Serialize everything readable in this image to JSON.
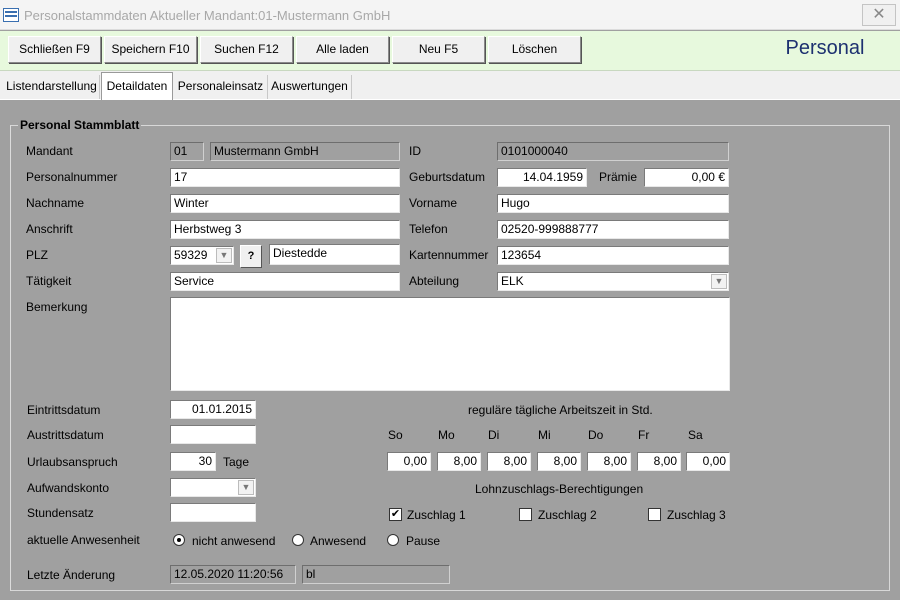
{
  "window": {
    "title": "Personalstammdaten Aktueller Mandant:01-Mustermann GmbH",
    "close_glyph": "✕"
  },
  "toolbar": {
    "buttons": [
      "Schließen F9",
      "Speichern F10",
      "Suchen F12",
      "Alle laden",
      "Neu F5",
      "Löschen"
    ],
    "brand": "Personal"
  },
  "tabs": [
    "Listendarstellung",
    "Detaildaten",
    "Personaleinsatz",
    "Auswertungen"
  ],
  "active_tab": "Detaildaten",
  "form": {
    "group_title": "Personal Stammblatt",
    "labels": {
      "mandant": "Mandant",
      "personalnummer": "Personalnummer",
      "nachname": "Nachname",
      "anschrift": "Anschrift",
      "plz": "PLZ",
      "taetigkeit": "Tätigkeit",
      "bemerkung": "Bemerkung",
      "id": "ID",
      "geburtsdatum": "Geburtsdatum",
      "praemie": "Prämie",
      "vorname": "Vorname",
      "telefon": "Telefon",
      "kartennummer": "Kartennummer",
      "abteilung": "Abteilung"
    },
    "values": {
      "mandant_nr": "01",
      "mandant_name": "Mustermann GmbH",
      "id": "0101000040",
      "personalnummer": "17",
      "geburtsdatum": "14.04.1959",
      "praemie": "0,00 €",
      "nachname": "Winter",
      "vorname": "Hugo",
      "anschrift": "Herbstweg 3",
      "telefon": "02520-999888777",
      "plz": "59329",
      "ort": "Diestedde",
      "kartennummer": "123654",
      "taetigkeit": "Service",
      "abteilung": "ELK",
      "bemerkung": ""
    },
    "plz_lookup_label": "?"
  },
  "lower": {
    "labels": {
      "eintrittsdatum": "Eintrittsdatum",
      "austrittsdatum": "Austrittsdatum",
      "urlaubsanspruch": "Urlaubsanspruch",
      "tage": "Tage",
      "aufwandskonto": "Aufwandskonto",
      "stundensatz": "Stundensatz",
      "anwesenheit": "aktuelle Anwesenheit",
      "letzte_aenderung": "Letzte Änderung"
    },
    "values": {
      "eintrittsdatum": "01.01.2015",
      "austrittsdatum": "",
      "urlaubsanspruch": "30",
      "aufwandskonto": "",
      "stundensatz": "",
      "letzte_aenderung_datum": "12.05.2020 11:20:56",
      "letzte_aenderung_user": "bl"
    },
    "anwesenheit_options": [
      "nicht anwesend",
      "Anwesend",
      "Pause"
    ],
    "anwesenheit_selected": "nicht anwesend"
  },
  "arbeitszeit": {
    "title": "reguläre tägliche Arbeitszeit in Std.",
    "days": [
      "So",
      "Mo",
      "Di",
      "Mi",
      "Do",
      "Fr",
      "Sa"
    ],
    "hours": [
      "0,00",
      "8,00",
      "8,00",
      "8,00",
      "8,00",
      "8,00",
      "0,00"
    ]
  },
  "zuschlaege": {
    "title": "Lohnzuschlags-Berechtigungen",
    "items": [
      {
        "label": "Zuschlag 1",
        "checked": true
      },
      {
        "label": "Zuschlag 2",
        "checked": false
      },
      {
        "label": "Zuschlag 3",
        "checked": false
      }
    ],
    "check_glyph": "✔"
  },
  "icons": {
    "combo": "chevron-down-icon",
    "close": "close-icon",
    "app": "app-icon"
  }
}
